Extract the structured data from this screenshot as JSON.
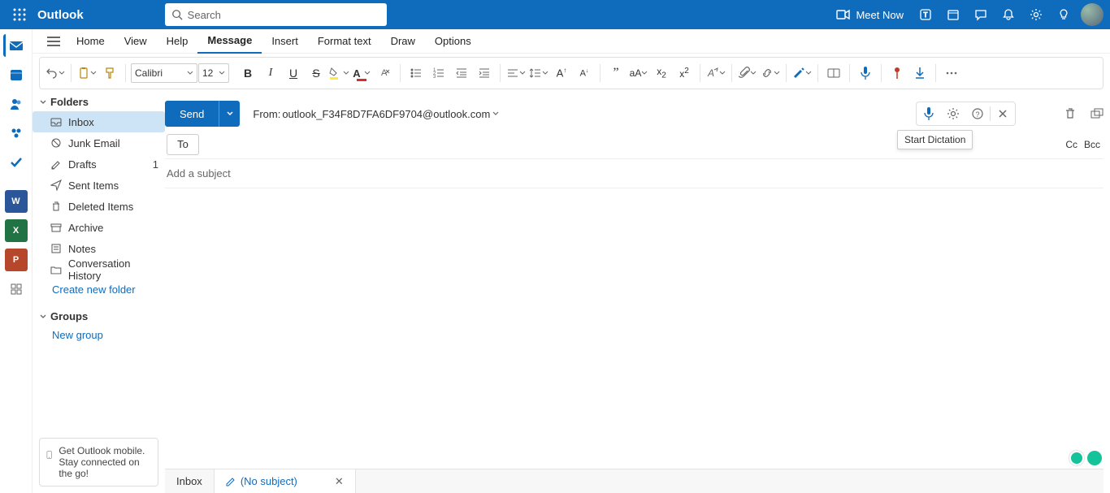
{
  "brand": "Outlook",
  "search_placeholder": "Search",
  "meet_now": "Meet Now",
  "ribbon_tabs": [
    "Home",
    "View",
    "Help",
    "Message",
    "Insert",
    "Format text",
    "Draw",
    "Options"
  ],
  "active_tab_index": 3,
  "font_name": "Calibri",
  "font_size": "12",
  "folders_header": "Folders",
  "folders": [
    {
      "label": "Inbox",
      "icon": "inbox",
      "active": true
    },
    {
      "label": "Junk Email",
      "icon": "junk"
    },
    {
      "label": "Drafts",
      "icon": "draft",
      "count": "1"
    },
    {
      "label": "Sent Items",
      "icon": "sent"
    },
    {
      "label": "Deleted Items",
      "icon": "trash"
    },
    {
      "label": "Archive",
      "icon": "archive"
    },
    {
      "label": "Notes",
      "icon": "notes"
    },
    {
      "label": "Conversation History",
      "icon": "history"
    }
  ],
  "create_folder": "Create new folder",
  "groups_header": "Groups",
  "new_group": "New group",
  "mobile_promo": "Get Outlook mobile. Stay connected on the go!",
  "send_label": "Send",
  "from_label": "From:",
  "from_address": "outlook_F34F8D7FA6DF9704@outlook.com",
  "tooltip_dictation": "Start Dictation",
  "to_label": "To",
  "cc_label": "Cc",
  "bcc_label": "Bcc",
  "subject_placeholder": "Add a subject",
  "bottom_tabs": {
    "inbox": "Inbox",
    "nosubject": "(No subject)"
  }
}
